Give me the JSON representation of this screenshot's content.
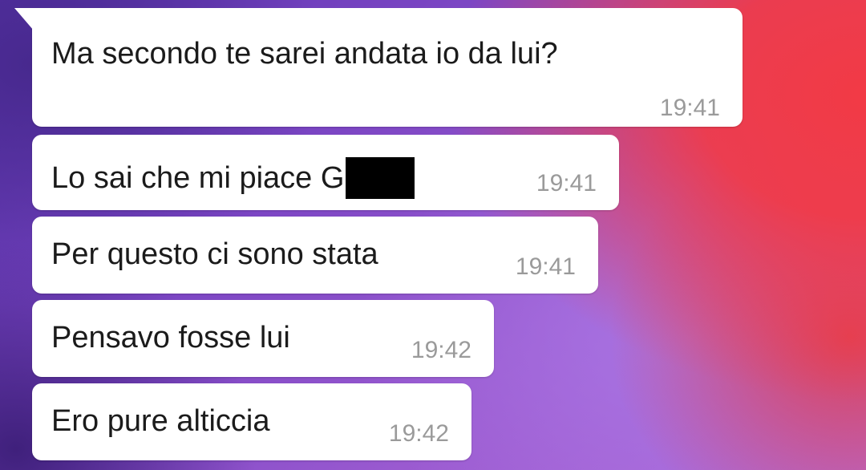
{
  "messages": [
    {
      "text": "Ma secondo te sarei andata io da lui?",
      "time": "19:41"
    },
    {
      "text": "Lo sai che mi piace G",
      "redacted": true,
      "time": "19:41"
    },
    {
      "text": "Per questo ci sono stata",
      "time": "19:41"
    },
    {
      "text": "Pensavo fosse lui",
      "time": "19:42"
    },
    {
      "text": "Ero pure alticcia",
      "time": "19:42"
    }
  ],
  "colors": {
    "bubble": "#ffffff",
    "text": "#1b1b1b",
    "timestamp": "#9a9a9a",
    "background_purple": "#7c46c4",
    "background_red": "#f23a45",
    "redaction": "#000000"
  }
}
